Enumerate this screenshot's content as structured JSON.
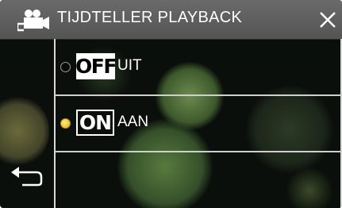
{
  "header": {
    "title": "TIJDTELLER PLAYBACK",
    "icon": "video-camera-icon",
    "close_icon": "close-icon"
  },
  "options": [
    {
      "badge": "OFF",
      "label": "UIT",
      "selected": false
    },
    {
      "badge": "ON",
      "label": "AAN",
      "selected": true
    }
  ],
  "footer": {
    "back_icon": "back-arrow-icon"
  },
  "colors": {
    "header_bg": "#5e5e5e",
    "selected_indicator": "#f0c400",
    "divider": "#cfcfcf",
    "screen_bg": "#0b0f0b"
  }
}
